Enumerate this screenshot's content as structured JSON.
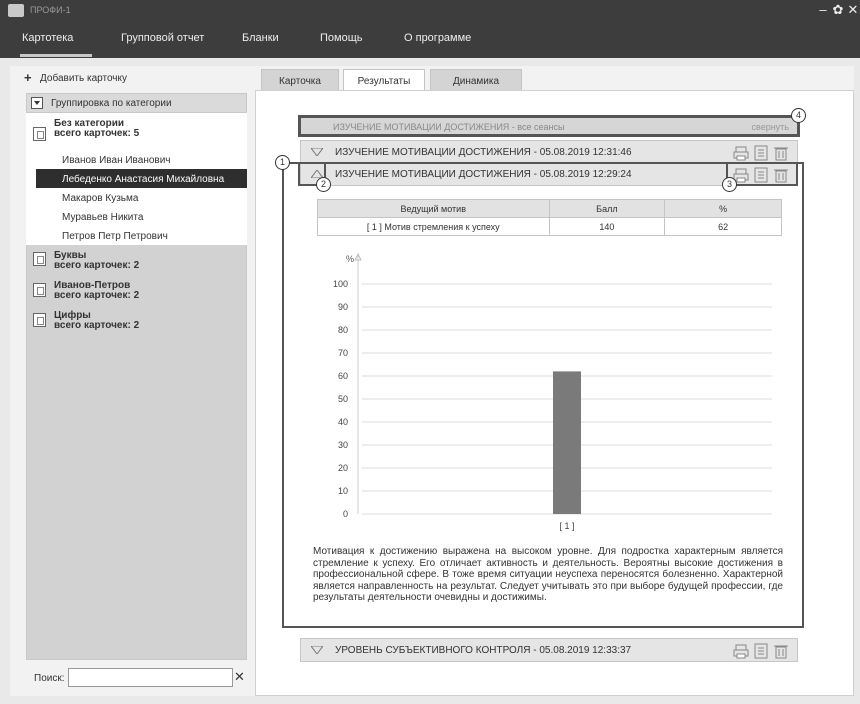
{
  "window": {
    "title": "ПРОФИ-1"
  },
  "menu": {
    "items": [
      "Картотека",
      "Групповой отчет",
      "Бланки",
      "Помощь",
      "О программе"
    ]
  },
  "left": {
    "add_label": "Добавить карточку",
    "group_label": "Группировка по категории",
    "categories": [
      {
        "name": "Без категории",
        "count": "всего карточек: 5"
      },
      {
        "name": "Буквы",
        "count": "всего карточек: 2"
      },
      {
        "name": "Иванов-Петров",
        "count": "всего карточек: 2"
      },
      {
        "name": "Цифры",
        "count": "всего карточек: 2"
      }
    ],
    "people": [
      "Иванов Иван Иванович",
      "Лебеденко Анастасия Михайловна",
      "Макаров Кузьма",
      "Муравьев Никита",
      "Петров Петр Петрович"
    ],
    "selected_person": "Лебеденко Анастасия Михайловна",
    "search_label": "Поиск:",
    "search_value": ""
  },
  "tabs": [
    "Карточка",
    "Результаты",
    "Динамика"
  ],
  "active_tab": "Результаты",
  "sessions": {
    "all_title": "ИЗУЧЕНИЕ МОТИВАЦИИ ДОСТИЖЕНИЯ - все сеансы",
    "collapse_label": "свернуть",
    "rows": [
      "ИЗУЧЕНИЕ МОТИВАЦИИ ДОСТИЖЕНИЯ - 05.08.2019  12:31:46",
      "ИЗУЧЕНИЕ МОТИВАЦИИ ДОСТИЖЕНИЯ - 05.08.2019  12:29:24",
      "УРОВЕНЬ СУБЪЕКТИВНОГО КОНТРОЛЯ - 05.08.2019  12:33:37"
    ]
  },
  "callouts": [
    "1",
    "2",
    "3",
    "4"
  ],
  "result_table": {
    "headers": [
      "Ведущий мотив",
      "Балл",
      "%"
    ],
    "rows": [
      [
        "[ 1 ] Мотив стремления к успеху",
        "140",
        "62"
      ]
    ]
  },
  "chart_data": {
    "type": "bar",
    "categories": [
      "[ 1 ]"
    ],
    "values": [
      62
    ],
    "ylabel": "%",
    "ylim": [
      0,
      100
    ],
    "yticks": [
      0,
      10,
      20,
      30,
      40,
      50,
      60,
      70,
      80,
      90,
      100
    ],
    "grid": true,
    "bar_color": "#7a7a7a"
  },
  "description": "Мотивация к достижению выражена на высоком уровне. Для подростка характерным является стремление к успеху. Его отличает активность и деятельность. Вероятны высокие достижения в профессиональной сфере. В тоже время ситуации неуспеха переносятся болезненно. Характерной является направленность на результат. Следует учитывать это при выборе будущей профессии, где результаты деятельности очевидны и достижимы."
}
